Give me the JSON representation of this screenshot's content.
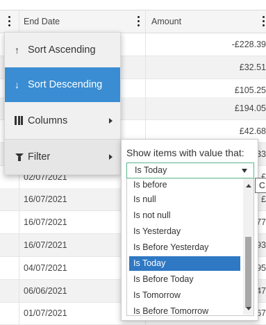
{
  "grid": {
    "columns": [
      {
        "label": ""
      },
      {
        "label": "End Date"
      },
      {
        "label": "Amount"
      }
    ],
    "rows": [
      {
        "end_date": "",
        "amount": "-£228.39"
      },
      {
        "end_date": "",
        "amount": "£32.51"
      },
      {
        "end_date": "",
        "amount": "£105.25"
      },
      {
        "end_date": "",
        "amount": "£194.05"
      },
      {
        "end_date": "",
        "amount": "£42.68"
      },
      {
        "end_date": "",
        "amount": "£33"
      },
      {
        "end_date": "02/07/2021",
        "amount": "£"
      },
      {
        "end_date": "16/07/2021",
        "amount": "£"
      },
      {
        "end_date": "16/07/2021",
        "amount": "£77"
      },
      {
        "end_date": "16/07/2021",
        "amount": "£93"
      },
      {
        "end_date": "04/07/2021",
        "amount": "£95"
      },
      {
        "end_date": "06/06/2021",
        "amount": "£47"
      },
      {
        "end_date": "01/07/2021",
        "amount": "£67"
      }
    ]
  },
  "menu": {
    "sort_asc": {
      "icon": "↑",
      "label": "Sort Ascending"
    },
    "sort_desc": {
      "icon": "↓",
      "label": "Sort Descending"
    },
    "columns": {
      "label": "Columns"
    },
    "filter": {
      "label": "Filter"
    }
  },
  "filter_panel": {
    "prompt": "Show items with value that:",
    "selected": "Is Today",
    "options": [
      "Is before",
      "Is null",
      "Is not null",
      "Is Yesterday",
      "Is Before Yesterday",
      "Is Today",
      "Is Before Today",
      "Is Tomorrow",
      "Is Before Tomorrow"
    ],
    "selected_index": 5
  },
  "tooltip": {
    "text": "C"
  },
  "colors": {
    "accent": "#3a8dd2",
    "selected_option": "#2f78c4",
    "select_border": "#59b38a",
    "row_alt": "#f2f2f2"
  }
}
